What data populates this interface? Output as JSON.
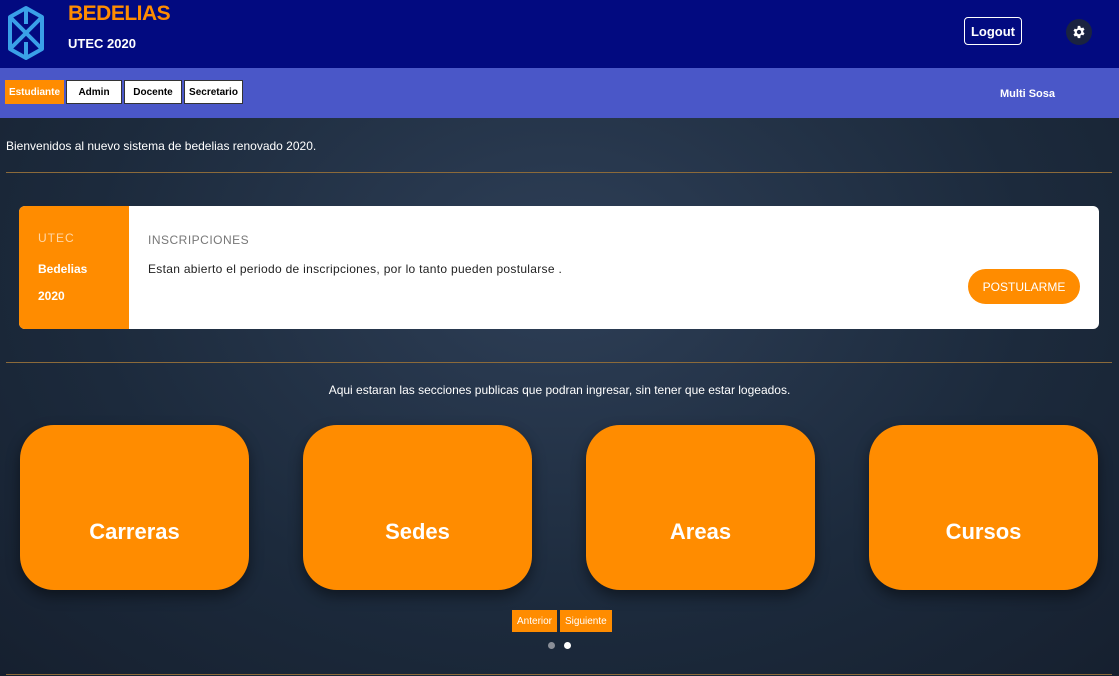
{
  "header": {
    "brand_title": "BEDELIAS",
    "brand_subtitle": "UTEC 2020",
    "logout_label": "Logout",
    "settings_icon": "gear-icon",
    "logo_icon": "hexagon-logo-icon"
  },
  "nav": {
    "tabs": [
      {
        "label": "Estudiante",
        "active": true
      },
      {
        "label": "Admin",
        "active": false
      },
      {
        "label": "Docente",
        "active": false
      },
      {
        "label": "Secretario",
        "active": false
      }
    ],
    "user_name": "Multi Sosa"
  },
  "welcome_text": "Bienvenidos al nuevo sistema de bedelias renovado 2020.",
  "announcement": {
    "side_line1": "UTEC",
    "side_line2": "Bedelias",
    "side_line3": "2020",
    "heading": "INSCRIPCIONES",
    "text": "Estan abierto el periodo de inscripciones, por lo tanto pueden postularse .",
    "button_label": "POSTULARME"
  },
  "sections": {
    "note": "Aqui estaran las secciones publicas que podran ingresar, sin tener que estar logeados.",
    "tiles": [
      {
        "label": "Carreras"
      },
      {
        "label": "Sedes"
      },
      {
        "label": "Areas"
      },
      {
        "label": "Cursos"
      }
    ],
    "prev_label": "Anterior",
    "next_label": "Siguiente",
    "page_count": 2,
    "current_page": 2
  },
  "colors": {
    "header_bg": "#020a80",
    "nav_bg": "#4a57c8",
    "accent": "#ff8c00",
    "page_bg": "#1c2a3c"
  }
}
